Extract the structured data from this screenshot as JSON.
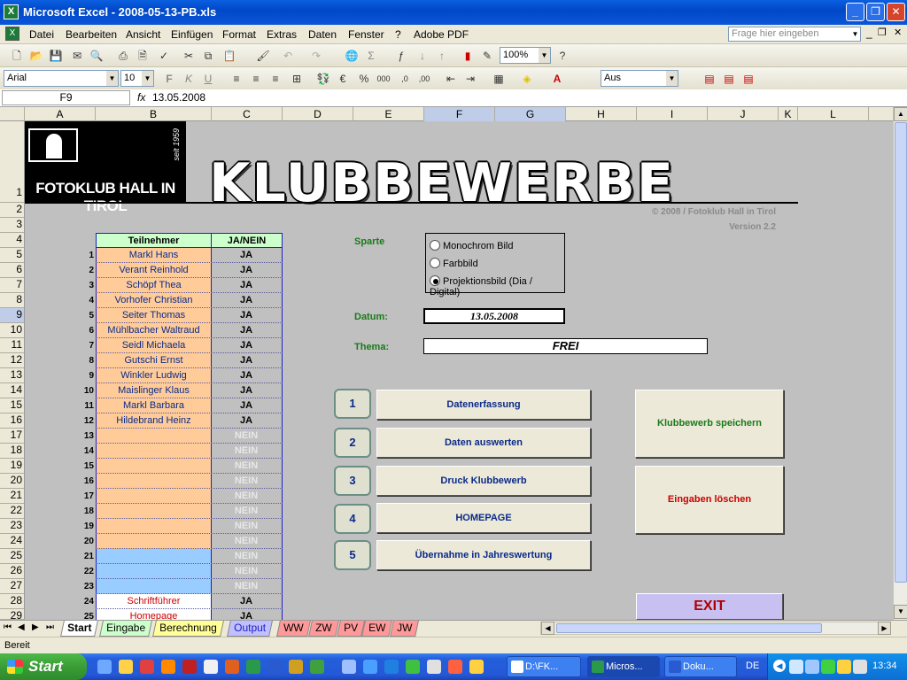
{
  "window": {
    "title": "Microsoft Excel - 2008-05-13-PB.xls"
  },
  "menu": {
    "items": [
      "Datei",
      "Bearbeiten",
      "Ansicht",
      "Einfügen",
      "Format",
      "Extras",
      "Daten",
      "Fenster",
      "?",
      "Adobe PDF"
    ],
    "help_placeholder": "Frage hier eingeben"
  },
  "toolbar": {
    "zoom": "100%",
    "font": "Arial",
    "font_size": "10",
    "style_dropdown": "Aus"
  },
  "formula_bar": {
    "cell": "F9",
    "fx": "fx",
    "value": "13.05.2008"
  },
  "columns": [
    "A",
    "B",
    "C",
    "D",
    "E",
    "F",
    "G",
    "H",
    "I",
    "J",
    "K",
    "L"
  ],
  "rows": [
    "1",
    "2",
    "3",
    "4",
    "5",
    "6",
    "7",
    "8",
    "9",
    "10",
    "11",
    "12",
    "13",
    "14",
    "15",
    "16",
    "17",
    "18",
    "19",
    "20",
    "21",
    "22",
    "23",
    "24",
    "25",
    "26",
    "27",
    "28",
    "29"
  ],
  "sheet": {
    "logo_name": "FOTOKLUB HALL IN TIROL",
    "logo_since": "seit 1959",
    "title": "KLUBBEWERBE",
    "copyright": "© 2008 / Fotoklub Hall in Tirol",
    "version": "Version 2.2",
    "table_header": {
      "participant": "Teilnehmer",
      "yesno": "JA/NEIN"
    },
    "participants": [
      {
        "n": "1",
        "name": "Markl Hans",
        "v": "JA"
      },
      {
        "n": "2",
        "name": "Verant Reinhold",
        "v": "JA"
      },
      {
        "n": "3",
        "name": "Schöpf Thea",
        "v": "JA"
      },
      {
        "n": "4",
        "name": "Vorhofer Christian",
        "v": "JA"
      },
      {
        "n": "5",
        "name": "Seiter Thomas",
        "v": "JA"
      },
      {
        "n": "6",
        "name": "Mühlbacher Waltraud",
        "v": "JA"
      },
      {
        "n": "7",
        "name": "Seidl Michaela",
        "v": "JA"
      },
      {
        "n": "8",
        "name": "Gutschi Ernst",
        "v": "JA"
      },
      {
        "n": "9",
        "name": "Winkler Ludwig",
        "v": "JA"
      },
      {
        "n": "10",
        "name": "Maislinger Klaus",
        "v": "JA"
      },
      {
        "n": "11",
        "name": "Markl Barbara",
        "v": "JA"
      },
      {
        "n": "12",
        "name": "Hildebrand Heinz",
        "v": "JA"
      },
      {
        "n": "13",
        "name": "",
        "v": "NEIN"
      },
      {
        "n": "14",
        "name": "",
        "v": "NEIN"
      },
      {
        "n": "15",
        "name": "",
        "v": "NEIN"
      },
      {
        "n": "16",
        "name": "",
        "v": "NEIN"
      },
      {
        "n": "17",
        "name": "",
        "v": "NEIN"
      },
      {
        "n": "18",
        "name": "",
        "v": "NEIN"
      },
      {
        "n": "19",
        "name": "",
        "v": "NEIN"
      },
      {
        "n": "20",
        "name": "",
        "v": "NEIN"
      },
      {
        "n": "21",
        "name": "",
        "v": "NEIN"
      },
      {
        "n": "22",
        "name": "",
        "v": "NEIN"
      },
      {
        "n": "23",
        "name": "",
        "v": "NEIN"
      },
      {
        "n": "24",
        "name": "Schriftführer",
        "v": "JA"
      },
      {
        "n": "25",
        "name": "Homepage",
        "v": "JA"
      }
    ],
    "sparte_label": "Sparte",
    "sparte_options": [
      "Monochrom Bild",
      "Farbbild",
      "Projektionsbild (Dia / Digital)"
    ],
    "sparte_selected_index": 2,
    "datum_label": "Datum:",
    "datum_value": "13.05.2008",
    "thema_label": "Thema:",
    "thema_value": "FREI",
    "actions": [
      {
        "n": "1",
        "label": "Datenerfassung"
      },
      {
        "n": "2",
        "label": "Daten auswerten"
      },
      {
        "n": "3",
        "label": "Druck Klubbewerb"
      },
      {
        "n": "4",
        "label": "HOMEPAGE"
      },
      {
        "n": "5",
        "label": "Übernahme in Jahreswertung"
      }
    ],
    "save_button": "Klubbewerb speichern",
    "clear_button": "Eingaben löschen",
    "exit_button": "EXIT"
  },
  "sheet_tabs": [
    "Start",
    "Eingabe",
    "Berechnung",
    "Output",
    "WW",
    "ZW",
    "PV",
    "EW",
    "JW"
  ],
  "status": "Bereit",
  "taskbar": {
    "start": "Start",
    "tasks": [
      "D:\\FK...",
      "Micros...",
      "Doku..."
    ],
    "lang": "DE",
    "clock": "13:34"
  },
  "colors": {
    "accent_green": "#1a7a1a",
    "name_cells": "#ffcc99",
    "header_green": "#ccffcc",
    "action_text": "#0a2a8a",
    "danger_red": "#cc0000"
  }
}
